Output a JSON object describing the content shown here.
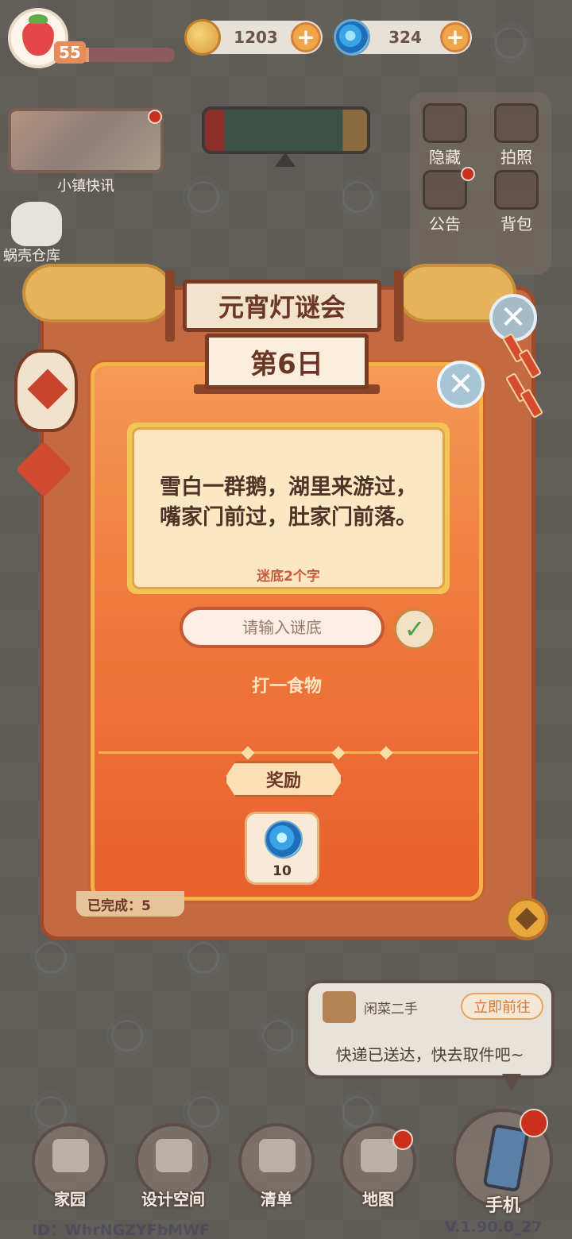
{
  "hud": {
    "level": "55",
    "xp_fraction": 0.1,
    "coins": "1203",
    "shells": "324"
  },
  "top_left": {
    "news_label": "小镇快讯",
    "storage_label": "蜗壳仓库"
  },
  "side_menu": {
    "hide": "隐藏",
    "photo": "拍照",
    "notice": "公告",
    "bag": "背包"
  },
  "event": {
    "title": "元宵灯谜会",
    "day": "第6日",
    "riddle_line1": "雪白一群鹅，湖里来游过，",
    "riddle_line2": "嘴家门前过，肚家门前落。",
    "hint": "迷底2个字",
    "answer_placeholder": "请输入谜底",
    "category": "打一食物",
    "reward_label": "奖励",
    "reward_count": "10",
    "completed": "已完成：5"
  },
  "notification": {
    "app": "闲菜二手",
    "go_label": "立即前往",
    "message": "快递已送达，快去取件吧~"
  },
  "nav": {
    "home": "家园",
    "design": "设计空间",
    "list": "清单",
    "map": "地图",
    "phone": "手机"
  },
  "footer": {
    "id": "ID：WhrNGZYFbMWF",
    "version": "V.1.90.0_27"
  },
  "colors": {
    "accent_orange": "#ef7a3e",
    "frame_brown": "#7c3c24",
    "gold": "#f5b24a",
    "alert_red": "#c9301d"
  }
}
